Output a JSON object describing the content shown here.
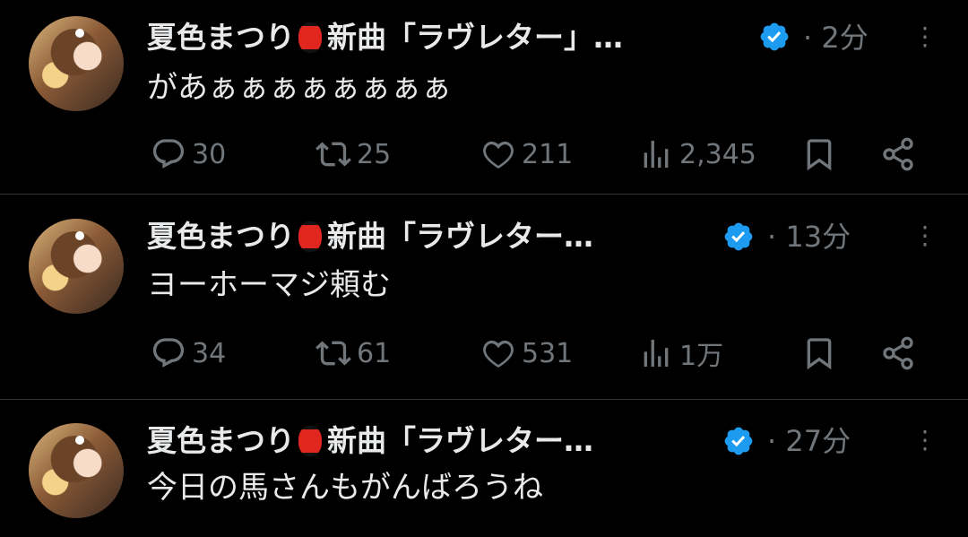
{
  "colors": {
    "background": "#000000",
    "text": "#e7e9ea",
    "muted": "#71767b",
    "verified": "#1d9bf0",
    "divider": "#2f3336",
    "lantern": "#e0261f"
  },
  "tweets": [
    {
      "author": "夏色まつり",
      "author_suffix": "新曲「ラヴレター」…",
      "time": "2分",
      "text": "があぁぁぁぁぁぁぁぁ",
      "replies": "30",
      "retweets": "25",
      "likes": "211",
      "views": "2,345"
    },
    {
      "author": "夏色まつり",
      "author_suffix": "新曲「ラヴレター…",
      "time": "13分",
      "text": "ヨーホーマジ頼む",
      "replies": "34",
      "retweets": "61",
      "likes": "531",
      "views": "1万"
    },
    {
      "author": "夏色まつり",
      "author_suffix": "新曲「ラヴレター…",
      "time": "27分",
      "text": "今日の馬さんもがんばろうね",
      "replies": "",
      "retweets": "",
      "likes": "",
      "views": ""
    }
  ],
  "icons": {
    "avatar": "avatar-image",
    "lantern": "lantern-emoji",
    "verified": "verified-badge-icon",
    "more": "more-dots-icon",
    "reply": "reply-icon",
    "retweet": "retweet-icon",
    "like": "heart-icon",
    "views": "views-icon",
    "bookmark": "bookmark-icon",
    "share": "share-icon"
  },
  "separator": "·"
}
